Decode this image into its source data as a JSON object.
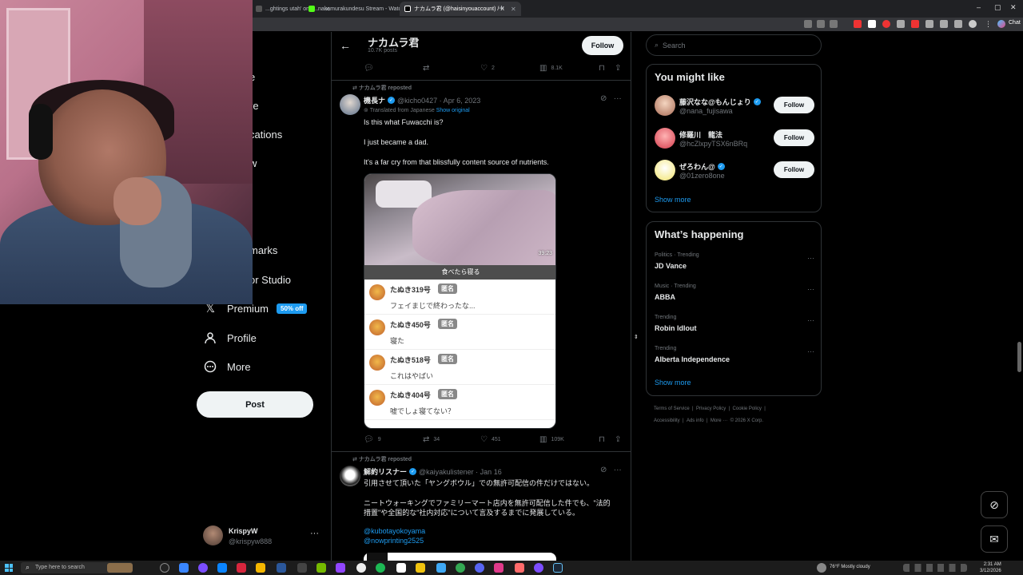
{
  "browser": {
    "tabs": [
      {
        "label": "...ghtings utah' on T..."
      },
      {
        "label": "nakamurakundesu Stream - Watch ..."
      },
      {
        "label": "ナカムラ君 (@haisinyouaccount) / X"
      }
    ],
    "right_label": "Chat"
  },
  "nav": {
    "partials": [
      "e",
      "re",
      "cations",
      "w",
      "marks",
      "or Studio"
    ],
    "premium": "Premium",
    "premium_badge": "50% off",
    "profile": "Profile",
    "more": "More",
    "post": "Post",
    "account_name": "KrispyW",
    "account_handle": "@krispyw888",
    "account_more": "···"
  },
  "header": {
    "title": "ナカムラ君",
    "subtitle": "10.7K posts",
    "follow": "Follow"
  },
  "top_actions": {
    "replies": "",
    "reposts": "",
    "likes": "2",
    "views": "8.1K"
  },
  "tweet1": {
    "repost_label": "ナカムラ君 reposted",
    "name": "機長ナ",
    "handle": "@kicho0427 · Apr 6, 2023",
    "translated": "Translated from Japanese",
    "show_original": "Show original",
    "lines": [
      "Is this what Fuwacchi is?",
      "I just became a dad.",
      "It's a far cry from that blissfully content source of nutrients."
    ],
    "media": {
      "duration": "39:23",
      "caption": "食べたら寝る",
      "comments": [
        {
          "name": "たぬき319号",
          "tag": "匿名",
          "text": "フェイまじで終わったな..."
        },
        {
          "name": "たぬき450号",
          "tag": "匿名",
          "text": "寝た"
        },
        {
          "name": "たぬき518号",
          "tag": "匿名",
          "text": "これはやばい"
        },
        {
          "name": "たぬき404号",
          "tag": "匿名",
          "text": "嘘でしょ寝てない？"
        }
      ]
    },
    "actions": {
      "replies": "9",
      "reposts": "34",
      "likes": "451",
      "views": "109K"
    }
  },
  "tweet2": {
    "repost_label": "ナカムラ君 reposted",
    "name": "解約リスナー",
    "handle": "@kaiyakulistener · Jan 16",
    "lines": [
      "引用させて頂いた「ヤングボウル」での無許可配信の件だけではない。",
      "ニートウォーキングでファミリーマート店内を無許可配信した件でも、\"法的",
      "措置\"や全国的な\"社内対応\"について言及するまでに発展している。"
    ],
    "links": [
      "@kubotayokoyama",
      "@nowprinting2525"
    ]
  },
  "search": {
    "placeholder": "Search"
  },
  "might_like": {
    "title": "You might like",
    "users": [
      {
        "name": "藤沢なな@もんじょり",
        "handle": "@nana_fujisawa",
        "verified": true,
        "follow": "Follow"
      },
      {
        "name": "修羅川　龍法",
        "handle": "@hcZlxpyTSX6nBRq",
        "verified": false,
        "follow": "Follow"
      },
      {
        "name": "ぜろわん@",
        "handle": "@01zero8one",
        "verified": true,
        "follow": "Follow"
      }
    ],
    "show_more": "Show more"
  },
  "happening": {
    "title": "What’s happening",
    "trends": [
      {
        "context": "Politics · Trending",
        "topic": "JD Vance"
      },
      {
        "context": "Music · Trending",
        "topic": "ABBA"
      },
      {
        "context": "Trending",
        "topic": "Robin Idlout"
      },
      {
        "context": "Trending",
        "topic": "Alberta Independence"
      }
    ],
    "show_more": "Show more"
  },
  "footer": {
    "row1": [
      "Terms of Service",
      "|",
      "Privacy Policy",
      "|",
      "Cookie Policy",
      "|"
    ],
    "row2": [
      "Accessibility",
      "|",
      "Ads info",
      "|",
      "More ···",
      "© 2026 X Corp."
    ]
  },
  "taskbar": {
    "search_placeholder": "Type here to search",
    "weather": "76°F  Mostly cloudy",
    "time": "2:31 AM",
    "date": "3/12/2026"
  },
  "colors": {
    "accent": "#1d9bf0",
    "background": "#000000",
    "border": "#2f3336",
    "muted": "#71767b"
  }
}
